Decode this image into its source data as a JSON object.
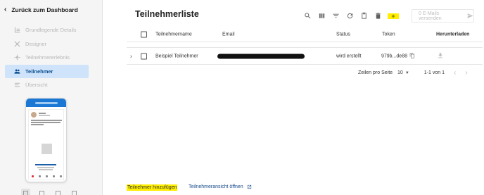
{
  "sidebar": {
    "back_label": "Zurück zum Dashboard",
    "items": [
      {
        "label": "Grundlegende Details",
        "icon": "hierarchy-icon",
        "active": false
      },
      {
        "label": "Designer",
        "icon": "designer-icon",
        "active": false
      },
      {
        "label": "Teilnehmererlebnis",
        "icon": "experience-icon",
        "active": false
      },
      {
        "label": "Teilnehmer",
        "icon": "people-icon",
        "active": true
      },
      {
        "label": "Übersicht",
        "icon": "list-icon",
        "active": false
      }
    ]
  },
  "main": {
    "title": "Teilnehmerliste",
    "send_label": "0 E-Mails versenden",
    "add_button_label": "+"
  },
  "table": {
    "columns": {
      "name": "Teilnehmername",
      "email": "Email",
      "status": "Status",
      "token": "Token",
      "download": "Herunterladen"
    },
    "rows": [
      {
        "name": "Beispiel Teilnehmer",
        "status": "wird erstellt",
        "token": "979b...de88"
      }
    ]
  },
  "pagination": {
    "rows_per_page_label": "Zeilen pro Seite",
    "rows_per_page_value": "10",
    "range": "1-1 von 1"
  },
  "footer": {
    "add_participant": "Teilnehmer hinzufügen",
    "open_view": "Teilnehmeransicht öffnen"
  },
  "colors": {
    "accent": "#ffee00",
    "active_bg": "#cfe4fb",
    "active_text": "#0b4d8f",
    "link": "#1a4d8c"
  }
}
